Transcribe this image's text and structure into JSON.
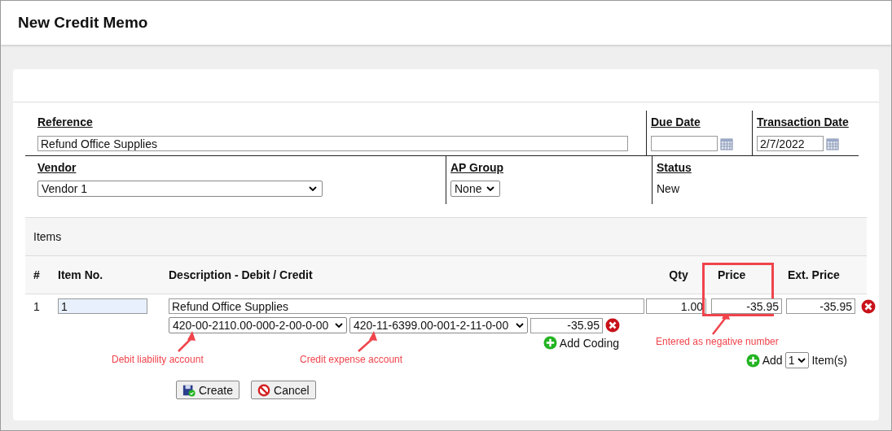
{
  "window": {
    "title": "New Credit Memo"
  },
  "header_fields": [
    {
      "kind": "text",
      "label": "Reference",
      "value": "Refund Office Supplies"
    },
    {
      "kind": "date",
      "label": "Due Date"
    },
    {
      "kind": "date",
      "label": "Transaction Date",
      "value": "2/7/2022"
    }
  ],
  "detail_fields": [
    {
      "kind": "select",
      "label": "Vendor",
      "value": "Vendor 1"
    },
    {
      "kind": "select",
      "label": "AP Group",
      "value": "None"
    },
    {
      "kind": "static",
      "label": "Status",
      "value": "New"
    }
  ],
  "items": {
    "title": "Items",
    "columns": [
      "#",
      "Item No.",
      "Description - Debit / Credit",
      "Qty",
      "Price",
      "Ext. Price"
    ],
    "rows": [
      {
        "index": "1",
        "item_no": "1",
        "description": "Refund Office Supplies",
        "qty": "1.00",
        "price": "-35.95",
        "ext_price": "-35.95",
        "coding": [
          {
            "debit_account": "420-00-2110.00-000-2-00-0-00",
            "credit_account": "420-11-6399.00-001-2-11-0-00",
            "amount": "-35.95"
          }
        ]
      }
    ],
    "add_coding": "Add Coding",
    "add_items": {
      "label": "Add",
      "count": "1",
      "suffix": "Item(s)"
    }
  },
  "buttons": [
    {
      "kind": "create",
      "label": "Create"
    },
    {
      "kind": "cancel",
      "label": "Cancel"
    }
  ],
  "annotations": [
    {
      "text": "Debit liability account"
    },
    {
      "text": "Credit expense account"
    },
    {
      "text": "Entered as negative number",
      "highlight": true
    }
  ]
}
